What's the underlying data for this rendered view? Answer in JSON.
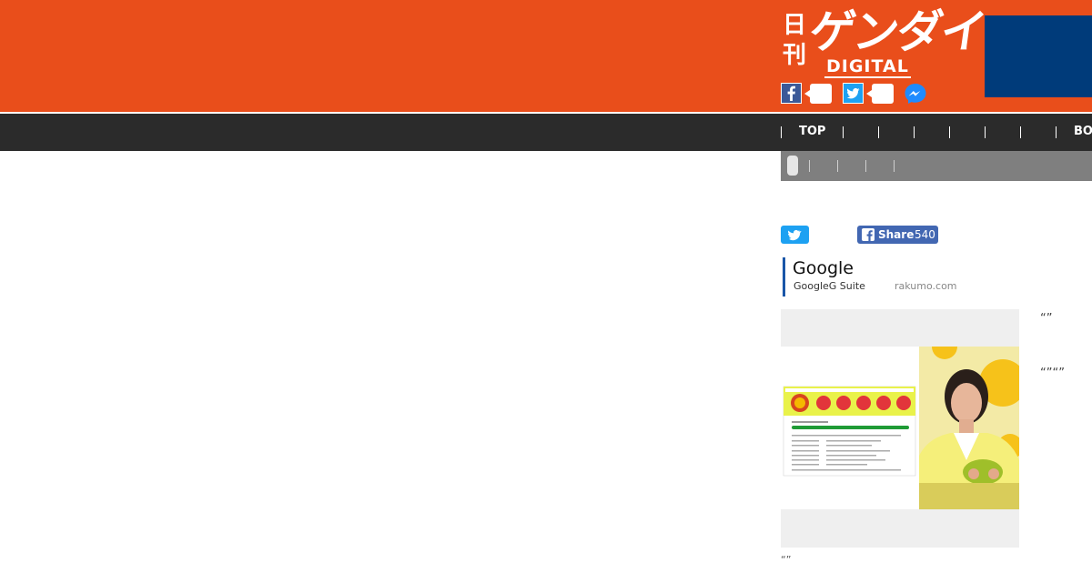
{
  "header": {
    "logo_kanji": "日刊",
    "logo_katakana": "ゲンダイ",
    "logo_sub": "DIGITAL",
    "colors": {
      "brand": "#e94e1b",
      "ad_box": "#003b7a",
      "nav": "#2b2b2b"
    }
  },
  "social": {
    "icons": [
      "facebook-icon",
      "twitter-icon",
      "messenger-icon"
    ]
  },
  "nav": {
    "items": [
      "TOP",
      "",
      "",
      "",
      "",
      "",
      "",
      "BO"
    ]
  },
  "share": {
    "facebook_label": "Share",
    "facebook_count": "540"
  },
  "ad": {
    "title": "Google",
    "subtitle": "GoogleG Suite",
    "url": "rakumo.com"
  },
  "side": {
    "quote1": "“”",
    "quote2": "“”“”"
  },
  "caption": "“”"
}
